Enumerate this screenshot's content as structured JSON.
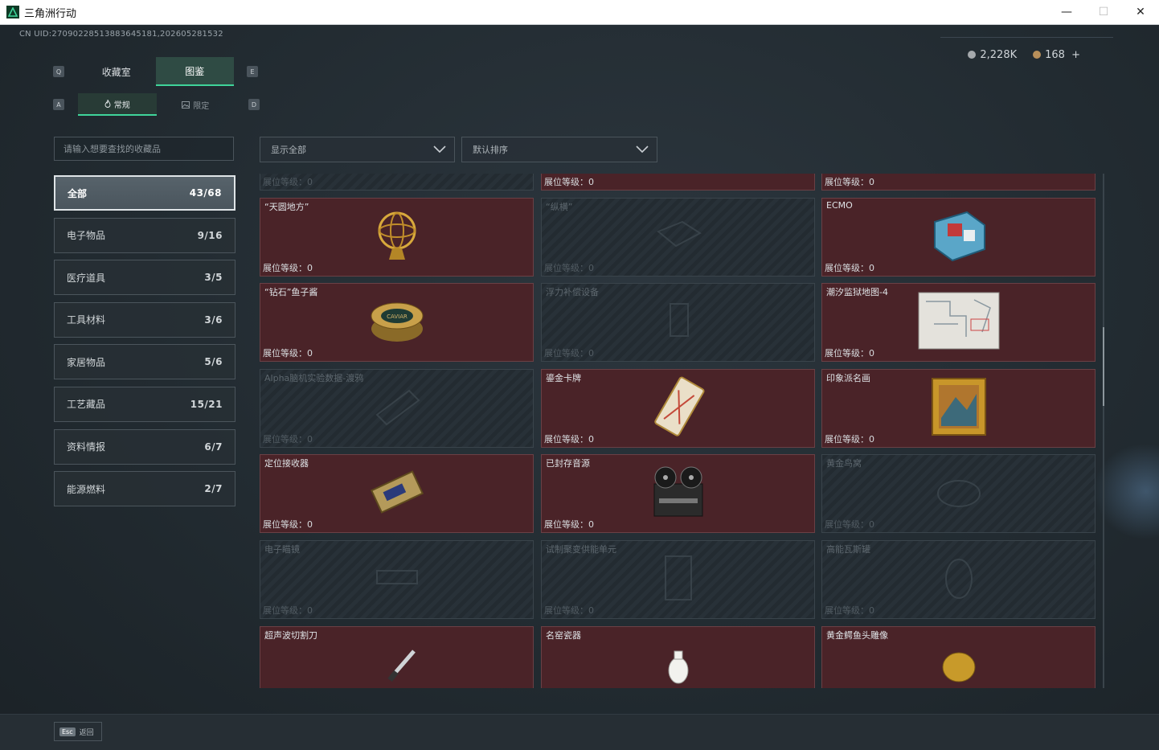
{
  "window": {
    "title": "三角洲行动",
    "minimize": "—",
    "maximize": "☐",
    "close": "✕"
  },
  "uid": "CN UID:27090228513883645181,202605281532",
  "currency": {
    "primary": "2,228K",
    "secondary": "168",
    "add": "+",
    "primary_color": "#a5a9ac",
    "secondary_color": "#b88f5a"
  },
  "key_hints": {
    "tab_left": "Q",
    "tab_right": "E",
    "sub_left": "A",
    "sub_right": "D"
  },
  "tabs": [
    {
      "label": "收藏室",
      "active": false
    },
    {
      "label": "图鉴",
      "active": true
    }
  ],
  "subtabs": [
    {
      "label": "常规",
      "icon": "flame-icon",
      "active": true
    },
    {
      "label": "限定",
      "icon": "image-icon",
      "active": false
    }
  ],
  "search": {
    "placeholder": "请输入想要查找的收藏品"
  },
  "filters": {
    "show": "显示全部",
    "sort": "默认排序"
  },
  "categories": [
    {
      "label": "全部",
      "count": "43/68",
      "active": true
    },
    {
      "label": "电子物品",
      "count": "9/16"
    },
    {
      "label": "医疗道具",
      "count": "3/5"
    },
    {
      "label": "工具材料",
      "count": "3/6"
    },
    {
      "label": "家居物品",
      "count": "5/6"
    },
    {
      "label": "工艺藏品",
      "count": "15/21"
    },
    {
      "label": "资料情报",
      "count": "6/7"
    },
    {
      "label": "能源燃料",
      "count": "2/7"
    }
  ],
  "level_label": "展位等级：",
  "items": [
    {
      "name": "",
      "level": "0",
      "owned": false,
      "icon": "robot-icon"
    },
    {
      "name": "",
      "level": "0",
      "owned": true,
      "icon": "gramophone-icon"
    },
    {
      "name": "",
      "level": "0",
      "owned": true,
      "icon": "golden-egg-icon"
    },
    {
      "name": "“天圆地方”",
      "level": "0",
      "owned": true,
      "icon": "armillary-sphere-icon"
    },
    {
      "name": "“纵横”",
      "level": "0",
      "owned": false,
      "icon": "chessboard-icon"
    },
    {
      "name": "ECMO",
      "level": "0",
      "owned": true,
      "icon": "ecmo-machine-icon"
    },
    {
      "name": "“钻石”鱼子酱",
      "level": "0",
      "owned": true,
      "icon": "caviar-tin-icon"
    },
    {
      "name": "浮力补偿设备",
      "level": "0",
      "owned": false,
      "icon": "buoyancy-device-icon"
    },
    {
      "name": "潮汐监狱地图-4",
      "level": "0",
      "owned": true,
      "icon": "map-icon"
    },
    {
      "name": "Alpha脑机实验数据-渡鸦",
      "level": "0",
      "owned": false,
      "icon": "data-drive-icon"
    },
    {
      "name": "鎏金卡牌",
      "level": "0",
      "owned": true,
      "icon": "gilded-card-icon"
    },
    {
      "name": "印象派名画",
      "level": "0",
      "owned": true,
      "icon": "painting-icon"
    },
    {
      "name": "定位接收器",
      "level": "0",
      "owned": true,
      "icon": "receiver-icon"
    },
    {
      "name": "已封存音源",
      "level": "0",
      "owned": true,
      "icon": "reel-recorder-icon"
    },
    {
      "name": "黄金鸟窝",
      "level": "0",
      "owned": false,
      "icon": "nest-icon"
    },
    {
      "name": "电子瞄镜",
      "level": "0",
      "owned": false,
      "icon": "scope-icon"
    },
    {
      "name": "试制聚变供能单元",
      "level": "0",
      "owned": false,
      "icon": "fusion-unit-icon"
    },
    {
      "name": "高能瓦斯罐",
      "level": "0",
      "owned": false,
      "icon": "gas-tank-icon"
    },
    {
      "name": "超声波切割刀",
      "level": "0",
      "owned": true,
      "icon": "cutter-icon"
    },
    {
      "name": "名窑瓷器",
      "level": "0",
      "owned": true,
      "icon": "porcelain-icon"
    },
    {
      "name": "黄金鳄鱼头雕像",
      "level": "0",
      "owned": true,
      "icon": "crocodile-statue-icon"
    }
  ],
  "footer": {
    "key": "Esc",
    "label": "返回"
  }
}
